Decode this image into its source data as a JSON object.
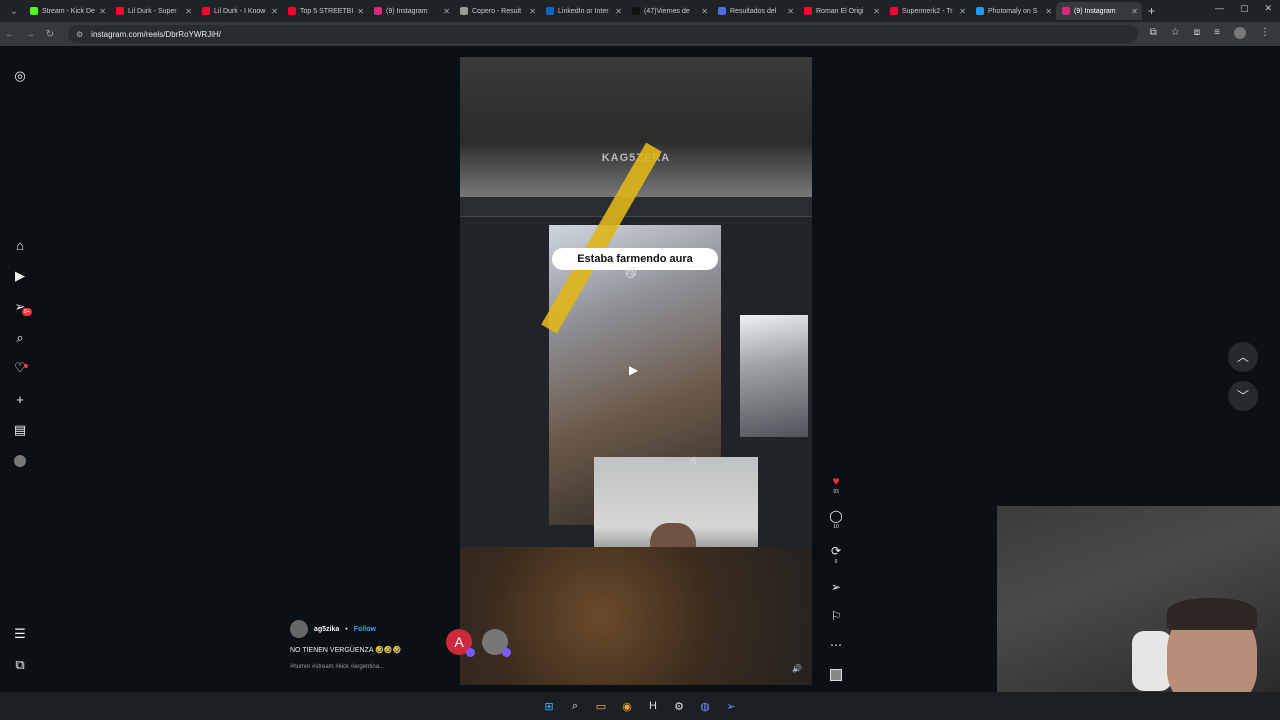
{
  "browser": {
    "tabs": [
      {
        "label": "Stream - Kick De",
        "color": "#53fc18"
      },
      {
        "label": "Lil Durk - Super",
        "color": "#ff0033"
      },
      {
        "label": "Lil Durk - I Know",
        "color": "#ff0033"
      },
      {
        "label": "Top 5 STREETBI",
        "color": "#ff0033"
      },
      {
        "label": "(9) Instagram",
        "color": "#d62976"
      },
      {
        "label": "Copero - Result",
        "color": "#999999"
      },
      {
        "label": "LinkedIn or Inter",
        "color": "#0a66c2"
      },
      {
        "label": "(47)Viernes de",
        "color": "#111111"
      },
      {
        "label": "Resultados del",
        "color": "#4a6ee0"
      },
      {
        "label": "Roman El Origi",
        "color": "#ff0033"
      },
      {
        "label": "Supermerk2 - Tr",
        "color": "#ff0033"
      },
      {
        "label": "Photomaly on S",
        "color": "#1d9bf0"
      },
      {
        "label": "(9) Instagram",
        "color": "#d62976",
        "active": true
      }
    ],
    "url": "instagram.com/reels/DbrRoYWRJiH/"
  },
  "reel": {
    "watermark": "KAG5ZERA",
    "overlay_caption": "Estaba farmendo aura",
    "overlay_emoji": "😼"
  },
  "actions": {
    "likes": "93",
    "comments": "10",
    "reposts": "6"
  },
  "author": {
    "username": "ag5zika",
    "separator": "•",
    "follow_label": "Follow"
  },
  "caption": "NO TIENEN VERGÜENZA 🤣🤣🤣",
  "hashtags": "#humor #stream #kick #argentina...",
  "mini_avatar_letter": "A",
  "notification_badge": "9+"
}
